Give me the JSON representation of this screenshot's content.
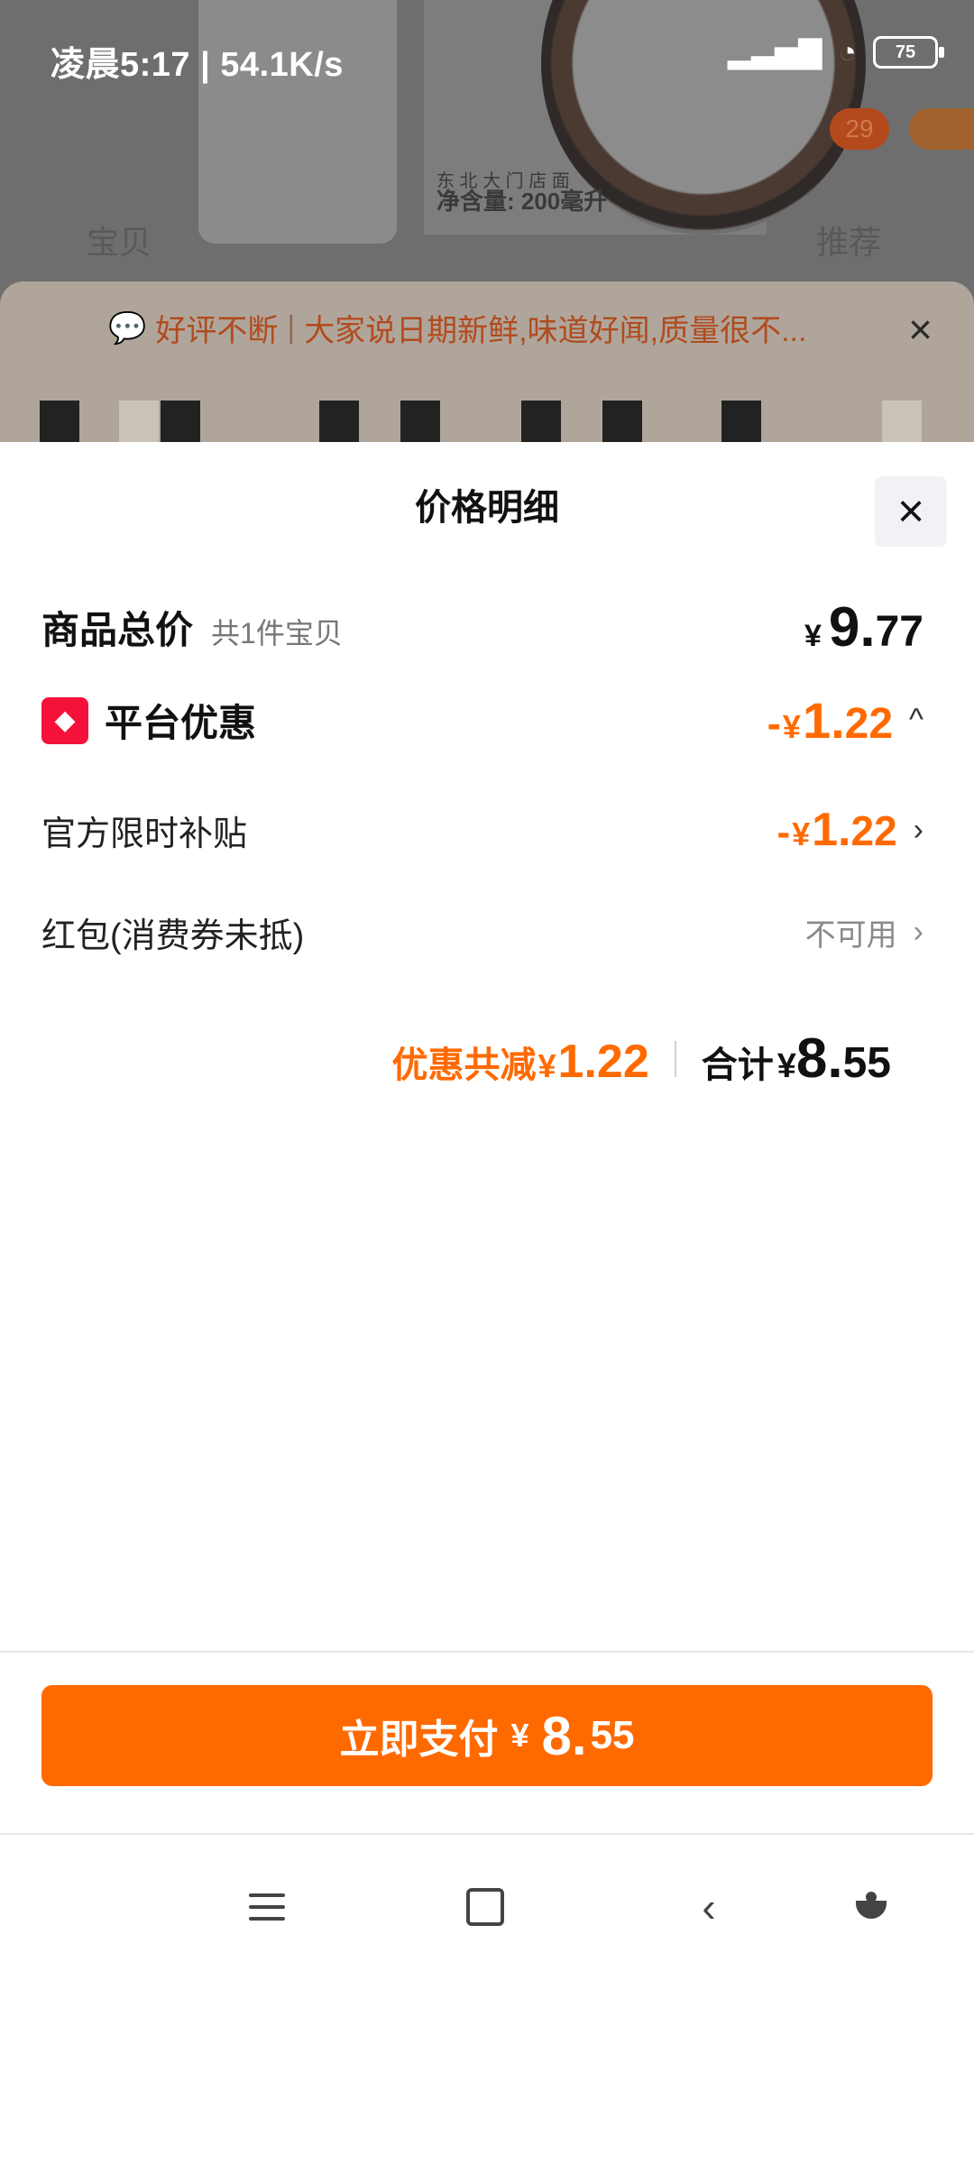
{
  "status_bar": {
    "left_text": "凌晨5:17 | 54.1K/s",
    "network": "HD",
    "battery": "75"
  },
  "background": {
    "package_text_line1": "东 北 大 门 店 面",
    "package_text_line2": "净含量: 200毫升",
    "badge_count": "29",
    "tab_left": "宝贝",
    "tab_right": "推荐"
  },
  "review_strip": {
    "tag": "好评不断",
    "text": "大家说日期新鲜,味道好闻,质量很不..."
  },
  "sheet": {
    "title": "价格明细",
    "close_icon": "close-icon"
  },
  "price_details": {
    "goods_total": {
      "label": "商品总价",
      "sub": "共1件宝贝",
      "currency": "¥",
      "int": "9.",
      "dec": "77"
    },
    "platform_discount": {
      "label": "平台优惠",
      "minus": "-",
      "currency": "¥",
      "int": "1.",
      "dec": "22",
      "icon": "tag-icon"
    },
    "official_subsidy": {
      "label": "官方限时补贴",
      "minus": "-",
      "currency": "¥",
      "int": "1.",
      "dec": "22"
    },
    "red_packet": {
      "label": "红包(消费券未抵)",
      "value": "不可用"
    }
  },
  "summary": {
    "discount_label": "优惠共减",
    "discount_currency": "¥",
    "discount_amount": "1.22",
    "total_label": "合计",
    "total_currency": "¥",
    "total_int": "8.",
    "total_dec": "55"
  },
  "pay_button": {
    "label": "立即支付",
    "currency": "¥",
    "int": "8.",
    "dec": "55"
  },
  "colors": {
    "accent": "#ff6a00",
    "tag_red": "#f5123a"
  }
}
